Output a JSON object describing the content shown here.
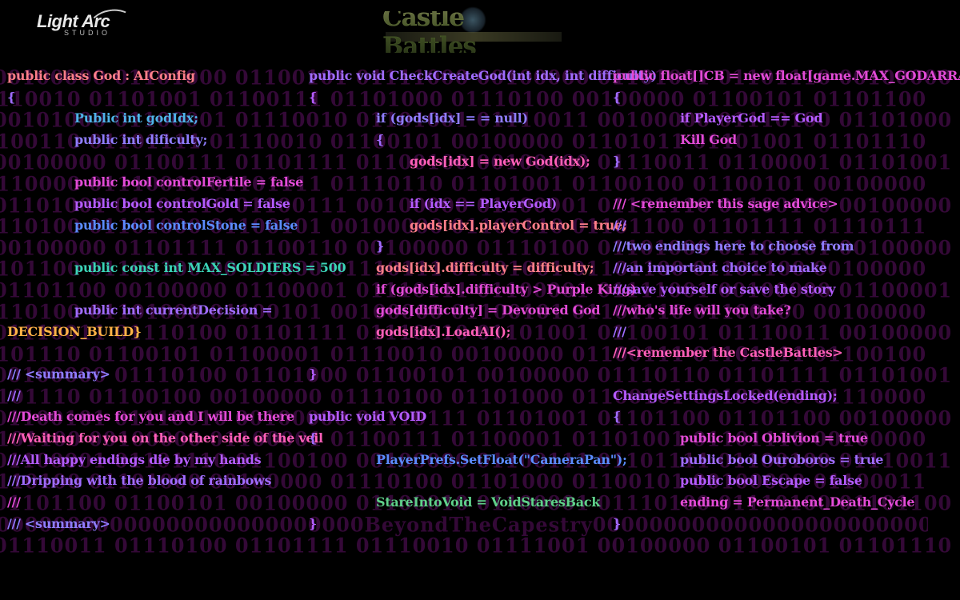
{
  "brand": {
    "studio_name": "Light Arc",
    "studio_sub": "STUDIO",
    "game_title": "Castle Battles"
  },
  "background_binary": [
    "00100000 01101000 01100101 01111000 00100000 01101001 01101110 00100000 01110100 01101000 01100101",
    "01110010 01101001 01100111 01101000 01110100 00100000 01100101 01101100 01101100 01110011 00100000",
    "00101000 01100001 01110010 01101001 01110011 00100000 01110100 01101000 01100101 01110010 01100101",
    "01100110 01101111 01110010 01100101 00100000 01101011 01101001 01101110 01100111 00100000 01110100",
    "00100000 01100111 01101111 01100100 00100000 01110011 01100001 01101001 01100100 00101100 00100000",
    "01110000 01110010 01101111 01110110 01101001 01100100 01100101 00100000 01100110 01101111 01110010",
    "01101001 01101110 01100111 00100000 01100001 01101110 01100100 00100000 01100001 01101100 01101100",
    "01110100 01101000 01100101 00100000 01100110 01101100 01101111 01110111 01100101 01110010 01110011",
    "00100000 01101111 01100110 00100000 01110100 01101000 01100101 00100000 01110111 01101111 01110010",
    "01101100 01100100 00100000 01110111 01101001 01101100 01101100 00100000 01100110 01100001 01101100",
    "01101100 00100000 01100001 01110111 01100001 01111001 00100000 01100001 01101110 01100100 00100000",
    "01110100 01101000 01100101 00100000 01100101 01101110 01100100 00100000 01101111 01100110 00100000",
    "01110011 01110100 01101111 01110010 01101001 01100101 01110011 00100000 01101001 01110011 00100000",
    "01101110 01100101 01100001 01110010 00100000 01100111 01101111 01100100 00100000 01101111 01100110",
    "00100000 01110100 01101000 01100101 00100000 01110110 01101111 01101001 01100100 00100000 01100001",
    "01101110 01100100 00100000 01110100 01101000 01100101 00100000 01110000 01101100 01100001 01111001",
    "01100101 01110010 00100000 01110111 01101001 01101100 01101100 00100000 01100110 01100001 01101100",
    "01101100 00100000 01100001 01100111 01100001 01101001 01101110 00100000 01101001 01101110 00100000",
    "01100001 01101110 01100100 00100000 01100111 01101111 01100100 01110011 00100000 01110111 01101001",
    "01110100 01101000 00100000 01110100 01101000 01100101 00100000 01100011 01100001 01110011 01110100",
    "01101100 01100101 00100000 01100010 01100001 01110100 01110100 01101100 01100101 01110011 00100000",
    "0000000000000000000000000000BeyondTheCapestry000000000000000000000000000",
    "01110011 01110100 01101111 01110010 01111001 00100000 01100101 01101110 01100100 01110011 00100000"
  ],
  "colors": {
    "blue": "#5b8cff",
    "sky": "#4fb3e8",
    "lavender": "#8f7dff",
    "violet": "#a06cff",
    "purple": "#b45cff",
    "magenta": "#e24bd6",
    "pink": "#ff5fb8",
    "salmon": "#ff7f8a",
    "teal": "#3bd4b8",
    "green": "#5fd08a",
    "olive": "#a7b56a",
    "gold": "#ffb347"
  },
  "code_lines": [
    {
      "col": 0,
      "row": 0,
      "indent": 0,
      "text": "public class God : AIConfig",
      "color": "salmon"
    },
    {
      "col": 0,
      "row": 1,
      "indent": 0,
      "text": "{",
      "color": "violet"
    },
    {
      "col": 0,
      "row": 2,
      "indent": 3,
      "text": "Public int godIdx;",
      "color": "sky"
    },
    {
      "col": 0,
      "row": 3,
      "indent": 3,
      "text": "public int dificulty;",
      "color": "lavender"
    },
    {
      "col": 0,
      "row": 5,
      "indent": 3,
      "text": "public bool controlFertile = false",
      "color": "magenta"
    },
    {
      "col": 0,
      "row": 6,
      "indent": 3,
      "text": "public bool controlGold = false",
      "color": "purple"
    },
    {
      "col": 0,
      "row": 7,
      "indent": 3,
      "text": "public bool controlStone = false",
      "color": "blue"
    },
    {
      "col": 0,
      "row": 9,
      "indent": 3,
      "text": "public const int MAX_SOLDIERS = 500",
      "color": "teal"
    },
    {
      "col": 0,
      "row": 11,
      "indent": 3,
      "text": "public int currentDecision =",
      "color": "violet"
    },
    {
      "col": 0,
      "row": 12,
      "indent": 0,
      "text": "DECISION_BUILD}",
      "color": "gold"
    },
    {
      "col": 0,
      "row": 14,
      "indent": 0,
      "text": "/// <summary>",
      "color": "lavender"
    },
    {
      "col": 0,
      "row": 15,
      "indent": 0,
      "text": "///",
      "color": "violet"
    },
    {
      "col": 0,
      "row": 16,
      "indent": 0,
      "text": "///Death comes for you and I will be there",
      "color": "magenta"
    },
    {
      "col": 0,
      "row": 17,
      "indent": 0,
      "text": "///Waiting for you on the other side of the veil",
      "color": "pink"
    },
    {
      "col": 0,
      "row": 18,
      "indent": 0,
      "text": "///All happy endings die by my hands",
      "color": "purple"
    },
    {
      "col": 0,
      "row": 19,
      "indent": 0,
      "text": "///Dripping with the blood of rainbows",
      "color": "violet"
    },
    {
      "col": 0,
      "row": 20,
      "indent": 0,
      "text": "///",
      "color": "magenta"
    },
    {
      "col": 0,
      "row": 21,
      "indent": 0,
      "text": "/// <summary>",
      "color": "lavender"
    },
    {
      "col": 1,
      "row": 0,
      "indent": 0,
      "text": "public void CheckCreateGod(int idx, int difficulty)",
      "color": "violet"
    },
    {
      "col": 1,
      "row": 1,
      "indent": 0,
      "text": "{",
      "color": "purple"
    },
    {
      "col": 1,
      "row": 2,
      "indent": 3,
      "text": "if (gods[idx] = = null)",
      "color": "lavender"
    },
    {
      "col": 1,
      "row": 3,
      "indent": 3,
      "text": "{",
      "color": "violet"
    },
    {
      "col": 1,
      "row": 4,
      "indent": 4.5,
      "text": "gods[idx] = new God(idx);",
      "color": "pink"
    },
    {
      "col": 1,
      "row": 6,
      "indent": 4.5,
      "text": "if (idx == PlayerGod)",
      "color": "purple"
    },
    {
      "col": 1,
      "row": 7,
      "indent": 4.5,
      "text": "gods[idx].playerControl = true;",
      "color": "salmon"
    },
    {
      "col": 1,
      "row": 8,
      "indent": 3,
      "text": "}",
      "color": "violet"
    },
    {
      "col": 1,
      "row": 9,
      "indent": 3,
      "text": "gods[idx].difficulty = difficulty;",
      "color": "salmon"
    },
    {
      "col": 1,
      "row": 10,
      "indent": 3,
      "text": "if (gods[idx].difficulty > Purple King)",
      "color": "magenta"
    },
    {
      "col": 1,
      "row": 11,
      "indent": 3,
      "text": "gods[difficulty] = Devoured God",
      "color": "magenta"
    },
    {
      "col": 1,
      "row": 12,
      "indent": 3,
      "text": "gods[idx].LoadAI();",
      "color": "pink"
    },
    {
      "col": 1,
      "row": 14,
      "indent": 0,
      "text": "}",
      "color": "purple"
    },
    {
      "col": 1,
      "row": 16,
      "indent": 0,
      "text": "public void VOID",
      "color": "purple"
    },
    {
      "col": 1,
      "row": 17,
      "indent": 0,
      "text": "{",
      "color": "violet"
    },
    {
      "col": 1,
      "row": 18,
      "indent": 3,
      "text": "PlayerPrefs.SetFloat(\"CameraPan\");",
      "color": "blue"
    },
    {
      "col": 1,
      "row": 20,
      "indent": 3,
      "text": "StareIntoVoid = VoidStaresBack",
      "color": "green"
    },
    {
      "col": 1,
      "row": 21,
      "indent": 0,
      "text": "}",
      "color": "purple"
    },
    {
      "col": 2,
      "row": 0,
      "indent": 0,
      "text": "public float[]CB = new float[game.MAX_GODARRAY];",
      "color": "magenta"
    },
    {
      "col": 2,
      "row": 1,
      "indent": 0,
      "text": "{",
      "color": "violet"
    },
    {
      "col": 2,
      "row": 2,
      "indent": 3,
      "text": "if PlayerGod == God",
      "color": "purple"
    },
    {
      "col": 2,
      "row": 3,
      "indent": 3,
      "text": "Kill God",
      "color": "magenta"
    },
    {
      "col": 2,
      "row": 4,
      "indent": 0,
      "text": "}",
      "color": "violet"
    },
    {
      "col": 2,
      "row": 6,
      "indent": 0,
      "text": "/// <remember this sage advice>",
      "color": "magenta"
    },
    {
      "col": 2,
      "row": 7,
      "indent": 0,
      "text": "///",
      "color": "violet"
    },
    {
      "col": 2,
      "row": 8,
      "indent": 0,
      "text": "///two endings here to choose from",
      "color": "lavender"
    },
    {
      "col": 2,
      "row": 9,
      "indent": 0,
      "text": "///an important choice to make",
      "color": "violet"
    },
    {
      "col": 2,
      "row": 10,
      "indent": 0,
      "text": "///save yourself or save the story",
      "color": "purple"
    },
    {
      "col": 2,
      "row": 11,
      "indent": 0,
      "text": "///who's life will you take?",
      "color": "magenta"
    },
    {
      "col": 2,
      "row": 12,
      "indent": 0,
      "text": "///",
      "color": "violet"
    },
    {
      "col": 2,
      "row": 13,
      "indent": 0,
      "text": "///<remember the CastleBattles>",
      "color": "pink"
    },
    {
      "col": 2,
      "row": 15,
      "indent": 0,
      "text": "ChangeSettingsLocked(ending);",
      "color": "purple"
    },
    {
      "col": 2,
      "row": 16,
      "indent": 0,
      "text": "{",
      "color": "violet"
    },
    {
      "col": 2,
      "row": 17,
      "indent": 3,
      "text": "public bool Oblivion = true",
      "color": "magenta"
    },
    {
      "col": 2,
      "row": 18,
      "indent": 3,
      "text": "public bool Ouroboros = true",
      "color": "violet"
    },
    {
      "col": 2,
      "row": 19,
      "indent": 3,
      "text": "public bool Escape = false",
      "color": "purple"
    },
    {
      "col": 2,
      "row": 20,
      "indent": 3,
      "text": "ending = Permanent_Death_Cycle",
      "color": "magenta"
    },
    {
      "col": 2,
      "row": 21,
      "indent": 0,
      "text": "}",
      "color": "violet"
    }
  ]
}
